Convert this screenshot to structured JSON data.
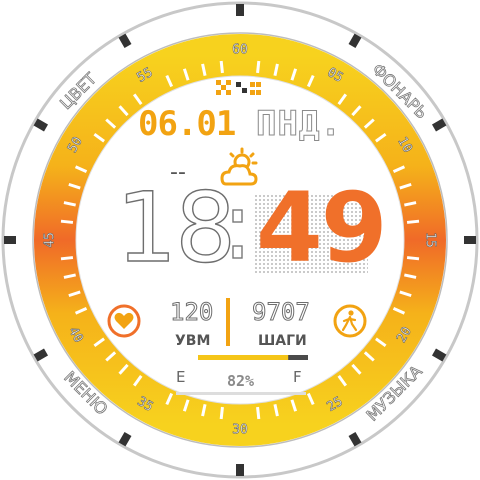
{
  "bezel": {
    "marks": [
      "60",
      "05",
      "10",
      "15",
      "20",
      "25",
      "30",
      "35",
      "40",
      "45",
      "50",
      "55"
    ]
  },
  "shortcuts": {
    "top_left": "ЦВЕТ",
    "top_right": "ФОНАРЬ",
    "bottom_left": "МЕНЮ",
    "bottom_right": "МУЗЫКА"
  },
  "date": {
    "day_month": "06.01",
    "weekday": "ПНД."
  },
  "weather": {
    "temperature": "--",
    "icon": "partly-cloudy-icon"
  },
  "time": {
    "hours": "18",
    "minutes": "49"
  },
  "heart": {
    "value": "120",
    "label": "УВМ",
    "icon": "heart-icon"
  },
  "steps": {
    "value": "9707",
    "label": "ШАГИ",
    "icon": "walking-icon"
  },
  "battery": {
    "empty_label": "E",
    "full_label": "F",
    "percent": "82%",
    "level": 0.82
  },
  "colors": {
    "accent": "#f2a312",
    "orange": "#f0702a",
    "yellow": "#f5d21a"
  }
}
